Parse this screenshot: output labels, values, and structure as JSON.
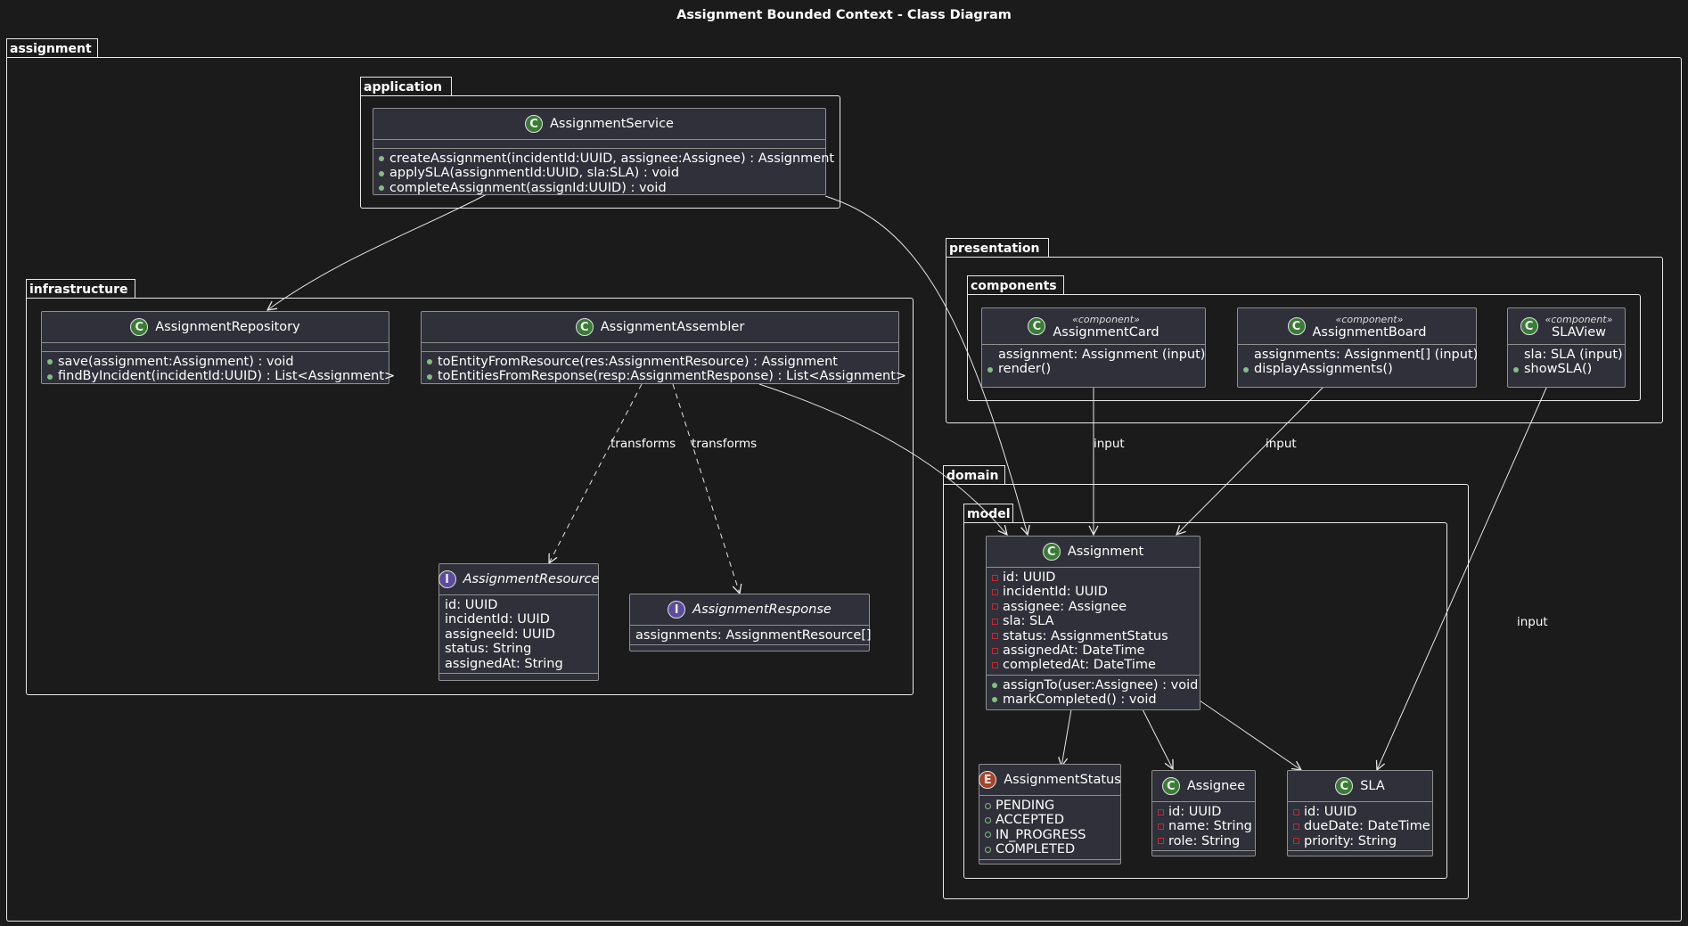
{
  "title": "Assignment Bounded Context - Class Diagram",
  "packages": {
    "assignment": "assignment",
    "application": "application",
    "infrastructure": "infrastructure",
    "presentation": "presentation",
    "components": "components",
    "domain": "domain",
    "model": "model"
  },
  "classes": {
    "assignment_service": {
      "name": "AssignmentService",
      "methods": [
        "createAssignment(incidentId:UUID, assignee:Assignee) : Assignment",
        "applySLA(assignmentId:UUID, sla:SLA) : void",
        "completeAssignment(assignId:UUID) : void"
      ]
    },
    "assignment_repository": {
      "name": "AssignmentRepository",
      "methods": [
        "save(assignment:Assignment) : void",
        "findByIncident(incidentId:UUID) : List<Assignment>"
      ]
    },
    "assignment_assembler": {
      "name": "AssignmentAssembler",
      "methods": [
        "toEntityFromResource(res:AssignmentResource) : Assignment",
        "toEntitiesFromResponse(resp:AssignmentResponse) : List<Assignment>"
      ]
    },
    "assignment_resource": {
      "name": "AssignmentResource",
      "fields": [
        "id: UUID",
        "incidentId: UUID",
        "assigneeId: UUID",
        "status: String",
        "assignedAt: String"
      ]
    },
    "assignment_response": {
      "name": "AssignmentResponse",
      "fields": [
        "assignments: AssignmentResource[]"
      ]
    },
    "assignment_card": {
      "stereotype": "«component»",
      "name": "AssignmentCard",
      "fields": [
        "assignment: Assignment (input)"
      ],
      "methods": [
        "render()"
      ]
    },
    "assignment_board": {
      "stereotype": "«component»",
      "name": "AssignmentBoard",
      "fields": [
        "assignments: Assignment[] (input)"
      ],
      "methods": [
        "displayAssignments()"
      ]
    },
    "sla_view": {
      "stereotype": "«component»",
      "name": "SLAView",
      "fields": [
        "sla: SLA (input)"
      ],
      "methods": [
        "showSLA()"
      ]
    },
    "assignment": {
      "name": "Assignment",
      "fields": [
        "id: UUID",
        "incidentId: UUID",
        "assignee: Assignee",
        "sla: SLA",
        "status: AssignmentStatus",
        "assignedAt: DateTime",
        "completedAt: DateTime"
      ],
      "methods": [
        "assignTo(user:Assignee) : void",
        "markCompleted() : void"
      ]
    },
    "assignment_status": {
      "name": "AssignmentStatus",
      "values": [
        "PENDING",
        "ACCEPTED",
        "IN_PROGRESS",
        "COMPLETED"
      ]
    },
    "assignee": {
      "name": "Assignee",
      "fields": [
        "id: UUID",
        "name: String",
        "role: String"
      ]
    },
    "sla": {
      "name": "SLA",
      "fields": [
        "id: UUID",
        "dueDate: DateTime",
        "priority: String"
      ]
    }
  },
  "edge_labels": {
    "transforms_1": "transforms",
    "transforms_2": "transforms",
    "card_input": "input",
    "board_input": "input",
    "slaview_input": "input"
  },
  "icons": {
    "class": "C",
    "interface": "I",
    "enum": "E"
  },
  "colors": {
    "background": "#1b1b1b",
    "class_fill": "#2f3039",
    "public": "#84be84",
    "private": "#c82930"
  }
}
